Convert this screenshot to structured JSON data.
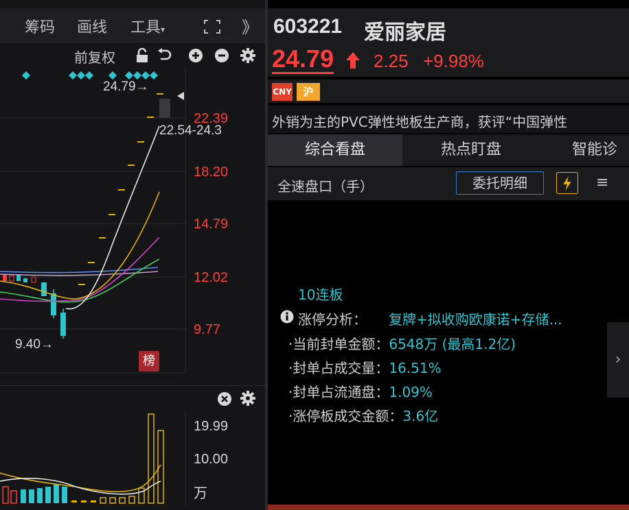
{
  "toolbar": {
    "tabs": [
      "筹码",
      "画线",
      "工具"
    ],
    "tool_caret": "▾",
    "collapse": "》",
    "adjust_label": "前复权"
  },
  "chart": {
    "price_labels": [
      "22.39",
      "18.20",
      "14.79",
      "12.02",
      "9.77"
    ],
    "high_annotation": "24.79→",
    "range_annotation": "22.54-24.3",
    "low_annotation": "9.40→",
    "rank_badge": "榜",
    "volume_labels": [
      "19.99",
      "10.00",
      "万"
    ]
  },
  "stock": {
    "code": "603221",
    "name": "爱丽家居",
    "price": "24.79",
    "change": "2.25",
    "change_pct": "+9.98%",
    "tag_currency": "CNY",
    "tag_market": "沪",
    "description": "外销为主的PVC弹性地板生产商，获评“中国弹性"
  },
  "modes": [
    "综合看盘",
    "热点盯盘",
    "智能诊"
  ],
  "panel": {
    "label": "全速盘口（手）",
    "order_detail": "委托明细",
    "menu_icon": "≡"
  },
  "limit_up": {
    "streak": "10连板",
    "reason_label": "涨停分析：",
    "reason_value": "复牌+拟收购欧康诺+存储...",
    "rows": [
      {
        "label": "·当前封单金额：",
        "value": "6548万 (最高1.2亿)"
      },
      {
        "label": "·封单占成交量：",
        "value": "16.51%"
      },
      {
        "label": "·封单占流通盘：",
        "value": "1.09%"
      },
      {
        "label": "·涨停板成交金额：",
        "value": "3.6亿"
      }
    ],
    "pager": "›"
  },
  "colors": {
    "up": "#ff3d3d",
    "accent": "#2ec5d0",
    "candle_down": "#2ec5d0",
    "ma_white": "#e8e8e8",
    "ma_yellow": "#e0b400",
    "ma_magenta": "#d63fd0",
    "ma_green": "#3fd05a",
    "ma_blue": "#5a8ef0"
  }
}
